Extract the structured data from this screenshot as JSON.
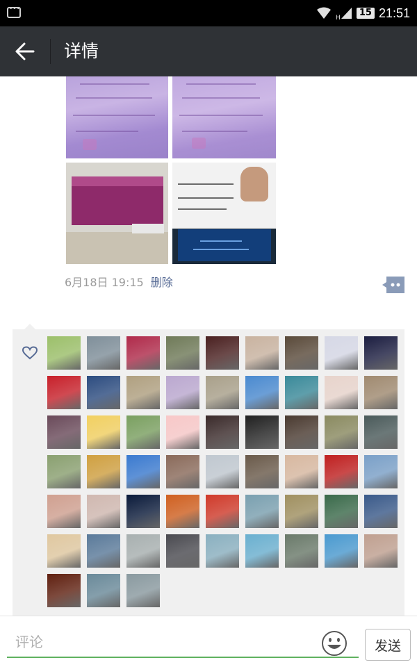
{
  "status_bar": {
    "battery": "15",
    "time": "21:51",
    "network_label": "H"
  },
  "header": {
    "title": "详情"
  },
  "post": {
    "timestamp": "6月18日 19:15",
    "delete_label": "删除"
  },
  "likes": {
    "avatar_colors": [
      "#9cc06a",
      "#7f8f9a",
      "#b02a4a",
      "#6f7a58",
      "#4a2020",
      "#c9b3a0",
      "#5a4a3a",
      "#d6d8e6",
      "#1b1d40",
      "#c8202a",
      "#2c4c80",
      "#b0a080",
      "#bba8d0",
      "#a9a08a",
      "#4a8ad0",
      "#3a8a9a",
      "#e8d4cc",
      "#a08a70",
      "#6a4a5a",
      "#f2d060",
      "#7aa060",
      "#f8c8c8",
      "#3a2a2a",
      "#202020",
      "#4a3a30",
      "#8a8a60",
      "#4a5a5a",
      "#8aa070",
      "#d0a040",
      "#3a7ad0",
      "#8a6a5a",
      "#c0c8d0",
      "#6a5a4a",
      "#d8b8a0",
      "#c02020",
      "#7aa0c8",
      "#d0a090",
      "#d0b8b0",
      "#0a1a3a",
      "#d06020",
      "#d03a2a",
      "#7aa0b0",
      "#a09060",
      "#3a6a4a",
      "#3a5a8a",
      "#e0c8a0",
      "#5a7a9a",
      "#a8b0b0",
      "#4a4a50",
      "#8ab0c0",
      "#6ab0d0",
      "#6a7a6a",
      "#4a9ad0",
      "#c0a090",
      "#602010",
      "#6a8a9a",
      "#8a9aa0"
    ]
  },
  "comment": {
    "placeholder": "评论",
    "send_label": "发送"
  }
}
